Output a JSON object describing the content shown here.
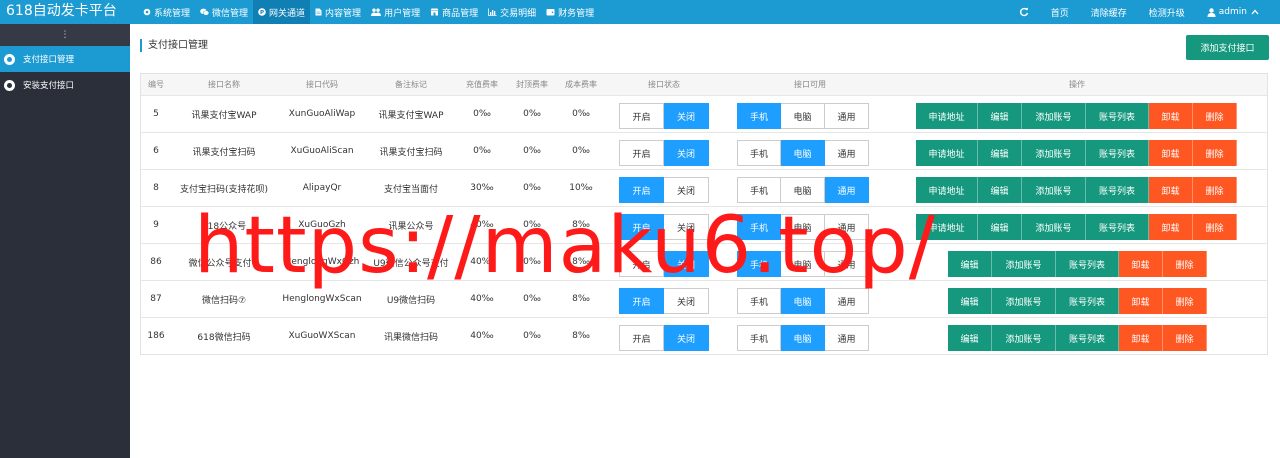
{
  "app": {
    "title": "618自动发卡平台"
  },
  "nav": [
    {
      "label": "系统管理",
      "icon": "gear-icon"
    },
    {
      "label": "微信管理",
      "icon": "wechat-icon"
    },
    {
      "label": "网关通道",
      "icon": "p-icon",
      "active": true
    },
    {
      "label": "内容管理",
      "icon": "document-icon"
    },
    {
      "label": "用户管理",
      "icon": "users-icon"
    },
    {
      "label": "商品管理",
      "icon": "shop-icon"
    },
    {
      "label": "交易明细",
      "icon": "bar-chart-icon"
    },
    {
      "label": "财务管理",
      "icon": "wallet-icon"
    }
  ],
  "right_nav": {
    "refresh_icon": "refresh-icon",
    "home": "首页",
    "clear_cache": "清除缓存",
    "check_update": "检测升级",
    "user": "admin",
    "user_icon": "user-icon",
    "caret_icon": "chevron-up-icon"
  },
  "sidebar": {
    "toggle": "⋮",
    "items": [
      {
        "label": "支付接口管理",
        "active": true
      },
      {
        "label": "安装支付接口",
        "active": false
      }
    ]
  },
  "page": {
    "title": "支付接口管理",
    "add_button": "添加支付接口"
  },
  "table": {
    "headers": [
      "编号",
      "接口名称",
      "接口代码",
      "备注标记",
      "充值费率",
      "封顶费率",
      "成本费率",
      "接口状态",
      "接口可用",
      "操作"
    ],
    "state_labels": {
      "on": "开启",
      "off": "关闭"
    },
    "device_labels": {
      "mobile": "手机",
      "pc": "电脑",
      "all": "通用"
    },
    "action_labels": {
      "apply": "申请地址",
      "edit": "编辑",
      "add_account": "添加账号",
      "account_list": "账号列表",
      "uninstall": "卸载",
      "delete": "删除"
    },
    "rows": [
      {
        "id": "5",
        "name": "讯果支付宝WAP",
        "code": "XunGuoAliWap",
        "remark": "讯果支付宝WAP",
        "rate": "0‰",
        "cap": "0‰",
        "cost": "0‰",
        "status": "off",
        "device": "mobile",
        "has_apply": true
      },
      {
        "id": "6",
        "name": "讯果支付宝扫码",
        "code": "XuGuoAliScan",
        "remark": "讯果支付宝扫码",
        "rate": "0‰",
        "cap": "0‰",
        "cost": "0‰",
        "status": "off",
        "device": "pc",
        "has_apply": true
      },
      {
        "id": "8",
        "name": "支付宝扫码(支持花呗)",
        "code": "AlipayQr",
        "remark": "支付宝当面付",
        "rate": "30‰",
        "cap": "0‰",
        "cost": "10‰",
        "status": "on",
        "device": "all",
        "has_apply": true
      },
      {
        "id": "9",
        "name": "618公众号",
        "code": "XuGuoGzh",
        "remark": "讯果公众号",
        "rate": "40‰",
        "cap": "0‰",
        "cost": "8‰",
        "status": "on",
        "device": "mobile",
        "has_apply": true
      },
      {
        "id": "86",
        "name": "微信公众号支付⑦",
        "code": "HenglongWxGzh",
        "remark": "U9微信公众号支付",
        "rate": "40‰",
        "cap": "0‰",
        "cost": "8‰",
        "status": "off",
        "device": "mobile",
        "has_apply": false
      },
      {
        "id": "87",
        "name": "微信扫码⑦",
        "code": "HenglongWxScan",
        "remark": "U9微信扫码",
        "rate": "40‰",
        "cap": "0‰",
        "cost": "8‰",
        "status": "on",
        "device": "pc",
        "has_apply": false
      },
      {
        "id": "186",
        "name": "618微信扫码",
        "code": "XuGuoWXScan",
        "remark": "讯果微信扫码",
        "rate": "40‰",
        "cap": "0‰",
        "cost": "8‰",
        "status": "off",
        "device": "pc",
        "has_apply": false
      }
    ]
  },
  "watermark": "https://maku6.top/"
}
